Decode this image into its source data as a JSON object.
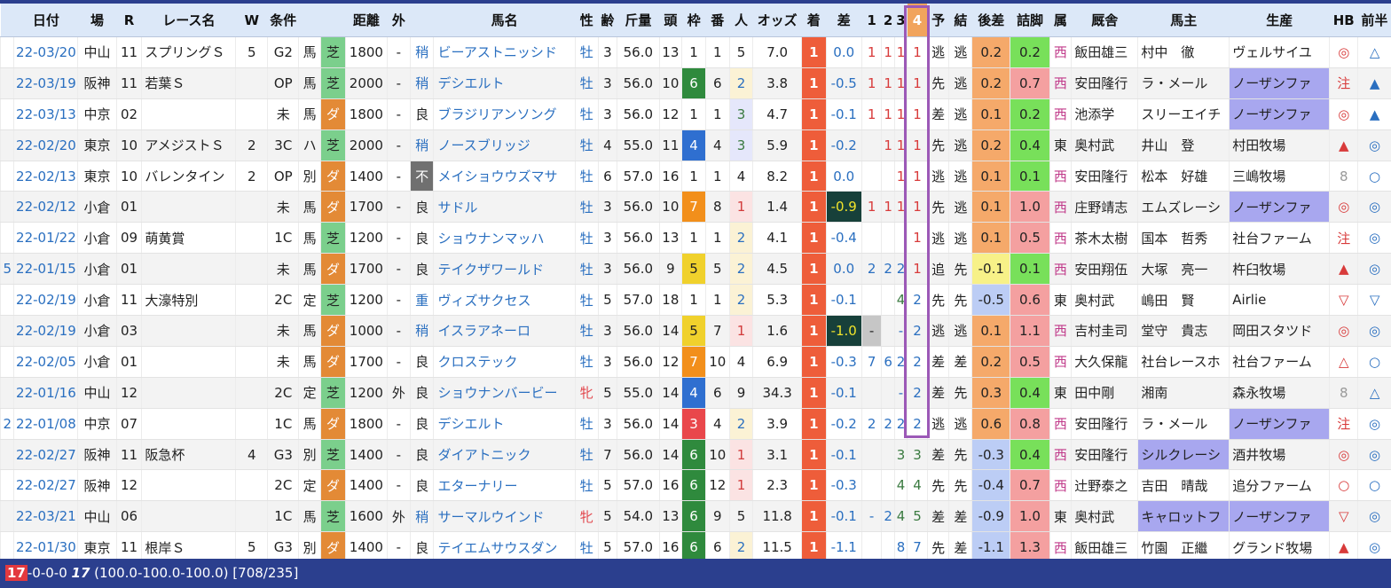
{
  "headers": [
    "",
    "日付",
    "場",
    "R",
    "レース名",
    "W",
    "条件",
    "",
    "",
    "距離",
    "外",
    "",
    "馬名",
    "性",
    "齢",
    "斤量",
    "頭",
    "枠",
    "番",
    "人",
    "オッズ",
    "着",
    "差",
    "1",
    "2",
    "3",
    "4",
    "予",
    "結",
    "後差",
    "詰脚",
    "属",
    "厩舎",
    "馬主",
    "生産",
    "HB",
    "前半"
  ],
  "rows": [
    {
      "pre": "",
      "date": "22-03/20",
      "venue": "中山",
      "r": "11",
      "race": "スプリングＳ",
      "w": "5",
      "grade": "G2",
      "cls": "馬",
      "surf": "芝",
      "dist": "1800",
      "out": "-",
      "cond": "稍",
      "horse": "ビーアストニッシド",
      "sex": "牡",
      "age": "3",
      "wt": "56.0",
      "field": "13",
      "gate": "1",
      "no": "1",
      "pop": "5",
      "odds": "7.0",
      "fin": "1",
      "margin": "0.0",
      "c1": "1",
      "c2": "1",
      "c3": "1",
      "c4": "1",
      "pred": "逃",
      "res": "逃",
      "late": "0.2",
      "kick": "0.2",
      "stable": "西",
      "trainer": "飯田雄三",
      "owner": "村中　徹",
      "breeder": "ヴェルサイユ",
      "hb": "◎",
      "half": "△"
    },
    {
      "pre": "",
      "date": "22-03/19",
      "venue": "阪神",
      "r": "11",
      "race": "若葉Ｓ",
      "w": "",
      "grade": "OP",
      "cls": "馬",
      "surf": "芝",
      "dist": "2000",
      "out": "-",
      "cond": "稍",
      "horse": "デシエルト",
      "sex": "牡",
      "age": "3",
      "wt": "56.0",
      "field": "10",
      "gate": "6",
      "no": "6",
      "pop": "2",
      "odds": "3.8",
      "fin": "1",
      "margin": "-0.5",
      "c1": "1",
      "c2": "1",
      "c3": "1",
      "c4": "1",
      "pred": "先",
      "res": "逃",
      "late": "0.2",
      "kick": "0.7",
      "stable": "西",
      "trainer": "安田隆行",
      "owner": "ラ・メール",
      "breeder": "ノーザンファ",
      "hb": "注",
      "half": "▲"
    },
    {
      "pre": "",
      "date": "22-03/13",
      "venue": "中京",
      "r": "02",
      "race": "",
      "w": "",
      "grade": "未",
      "cls": "馬",
      "surf": "ダ",
      "dist": "1800",
      "out": "-",
      "cond": "良",
      "horse": "ブラジリアンソング",
      "sex": "牡",
      "age": "3",
      "wt": "56.0",
      "field": "12",
      "gate": "1",
      "no": "1",
      "pop": "3",
      "odds": "4.7",
      "fin": "1",
      "margin": "-0.1",
      "c1": "1",
      "c2": "1",
      "c3": "1",
      "c4": "1",
      "pred": "差",
      "res": "逃",
      "late": "0.1",
      "kick": "0.2",
      "stable": "西",
      "trainer": "池添学",
      "owner": "スリーエイチ",
      "breeder": "ノーザンファ",
      "hb": "◎",
      "half": "▲"
    },
    {
      "pre": "",
      "date": "22-02/20",
      "venue": "東京",
      "r": "10",
      "race": "アメジストＳ",
      "w": "2",
      "grade": "3C",
      "cls": "ハ",
      "surf": "芝",
      "dist": "2000",
      "out": "-",
      "cond": "稍",
      "horse": "ノースブリッジ",
      "sex": "牡",
      "age": "4",
      "wt": "55.0",
      "field": "11",
      "gate": "4",
      "no": "4",
      "pop": "3",
      "odds": "5.9",
      "fin": "1",
      "margin": "-0.2",
      "c1": "",
      "c2": "1",
      "c3": "1",
      "c4": "1",
      "pred": "先",
      "res": "逃",
      "late": "0.2",
      "kick": "0.4",
      "stable": "東",
      "trainer": "奥村武",
      "owner": "井山　登",
      "breeder": "村田牧場",
      "hb": "▲",
      "half": "◎"
    },
    {
      "pre": "",
      "date": "22-02/13",
      "venue": "東京",
      "r": "10",
      "race": "バレンタイン",
      "w": "2",
      "grade": "OP",
      "cls": "別",
      "surf": "ダ",
      "dist": "1400",
      "out": "-",
      "cond": "不",
      "horse": "メイショウウズマサ",
      "sex": "牡",
      "age": "6",
      "wt": "57.0",
      "field": "16",
      "gate": "1",
      "no": "1",
      "pop": "4",
      "odds": "8.2",
      "fin": "1",
      "margin": "0.0",
      "c1": "",
      "c2": "",
      "c3": "1",
      "c4": "1",
      "pred": "逃",
      "res": "逃",
      "late": "0.1",
      "kick": "0.1",
      "stable": "西",
      "trainer": "安田隆行",
      "owner": "松本　好雄",
      "breeder": "三嶋牧場",
      "hb": "8",
      "half": "○"
    },
    {
      "pre": "",
      "date": "22-02/12",
      "venue": "小倉",
      "r": "01",
      "race": "",
      "w": "",
      "grade": "未",
      "cls": "馬",
      "surf": "ダ",
      "dist": "1700",
      "out": "-",
      "cond": "良",
      "horse": "サドル",
      "sex": "牡",
      "age": "3",
      "wt": "56.0",
      "field": "10",
      "gate": "7",
      "no": "8",
      "pop": "1",
      "odds": "1.4",
      "fin": "1",
      "margin": "-0.9",
      "c1": "1",
      "c2": "1",
      "c3": "1",
      "c4": "1",
      "pred": "先",
      "res": "逃",
      "late": "0.1",
      "kick": "1.0",
      "stable": "西",
      "trainer": "庄野靖志",
      "owner": "エムズレーシ",
      "breeder": "ノーザンファ",
      "hb": "◎",
      "half": "◎"
    },
    {
      "pre": "",
      "date": "22-01/22",
      "venue": "小倉",
      "r": "09",
      "race": "萌黄賞",
      "w": "",
      "grade": "1C",
      "cls": "馬",
      "surf": "芝",
      "dist": "1200",
      "out": "-",
      "cond": "良",
      "horse": "ショウナンマッハ",
      "sex": "牡",
      "age": "3",
      "wt": "56.0",
      "field": "13",
      "gate": "1",
      "no": "1",
      "pop": "2",
      "odds": "4.1",
      "fin": "1",
      "margin": "-0.4",
      "c1": "",
      "c2": "",
      "c3": "",
      "c4": "1",
      "pred": "逃",
      "res": "逃",
      "late": "0.1",
      "kick": "0.5",
      "stable": "西",
      "trainer": "茶木太樹",
      "owner": "国本　哲秀",
      "breeder": "社台ファーム",
      "hb": "注",
      "half": "◎"
    },
    {
      "pre": "5",
      "date": "22-01/15",
      "venue": "小倉",
      "r": "01",
      "race": "",
      "w": "",
      "grade": "未",
      "cls": "馬",
      "surf": "ダ",
      "dist": "1700",
      "out": "-",
      "cond": "良",
      "horse": "テイクザワールド",
      "sex": "牡",
      "age": "3",
      "wt": "56.0",
      "field": "9",
      "gate": "5",
      "no": "5",
      "pop": "2",
      "odds": "4.5",
      "fin": "1",
      "margin": "0.0",
      "c1": "2",
      "c2": "2",
      "c3": "2",
      "c4": "1",
      "pred": "追",
      "res": "先",
      "late": "-0.1",
      "kick": "0.1",
      "stable": "西",
      "trainer": "安田翔伍",
      "owner": "大塚　亮一",
      "breeder": "杵臼牧場",
      "hb": "▲",
      "half": "◎"
    },
    {
      "pre": "",
      "date": "22-02/19",
      "venue": "小倉",
      "r": "11",
      "race": "大濠特別",
      "w": "",
      "grade": "2C",
      "cls": "定",
      "surf": "芝",
      "dist": "1200",
      "out": "-",
      "cond": "重",
      "horse": "ヴィズサクセス",
      "sex": "牡",
      "age": "5",
      "wt": "57.0",
      "field": "18",
      "gate": "1",
      "no": "1",
      "pop": "2",
      "odds": "5.3",
      "fin": "1",
      "margin": "-0.1",
      "c1": "",
      "c2": "",
      "c3": "4",
      "c4": "2",
      "pred": "先",
      "res": "先",
      "late": "-0.5",
      "kick": "0.6",
      "stable": "東",
      "trainer": "奥村武",
      "owner": "嶋田　賢",
      "breeder": "Airlie",
      "hb": "▽",
      "half": "▽"
    },
    {
      "pre": "",
      "date": "22-02/19",
      "venue": "小倉",
      "r": "03",
      "race": "",
      "w": "",
      "grade": "未",
      "cls": "馬",
      "surf": "ダ",
      "dist": "1000",
      "out": "-",
      "cond": "稍",
      "horse": "イスラアネーロ",
      "sex": "牡",
      "age": "3",
      "wt": "56.0",
      "field": "14",
      "gate": "5",
      "no": "7",
      "pop": "1",
      "odds": "1.6",
      "fin": "1",
      "margin": "-1.0",
      "c1": "-",
      "c2": "",
      "c3": "-",
      "c4": "2",
      "pred": "逃",
      "res": "逃",
      "late": "0.1",
      "kick": "1.1",
      "stable": "西",
      "trainer": "吉村圭司",
      "owner": "堂守　貴志",
      "breeder": "岡田スタツド",
      "hb": "◎",
      "half": "◎"
    },
    {
      "pre": "",
      "date": "22-02/05",
      "venue": "小倉",
      "r": "01",
      "race": "",
      "w": "",
      "grade": "未",
      "cls": "馬",
      "surf": "ダ",
      "dist": "1700",
      "out": "-",
      "cond": "良",
      "horse": "クロステック",
      "sex": "牡",
      "age": "3",
      "wt": "56.0",
      "field": "12",
      "gate": "7",
      "no": "10",
      "pop": "4",
      "odds": "6.9",
      "fin": "1",
      "margin": "-0.3",
      "c1": "7",
      "c2": "6",
      "c3": "2",
      "c4": "2",
      "pred": "差",
      "res": "差",
      "late": "0.2",
      "kick": "0.5",
      "stable": "西",
      "trainer": "大久保龍",
      "owner": "社台レースホ",
      "breeder": "社台ファーム",
      "hb": "△",
      "half": "○"
    },
    {
      "pre": "",
      "date": "22-01/16",
      "venue": "中山",
      "r": "12",
      "race": "",
      "w": "",
      "grade": "2C",
      "cls": "定",
      "surf": "芝",
      "dist": "1200",
      "out": "外",
      "cond": "良",
      "horse": "ショウナンバービー",
      "sex": "牝",
      "age": "5",
      "wt": "55.0",
      "field": "14",
      "gate": "4",
      "no": "6",
      "pop": "9",
      "odds": "34.3",
      "fin": "1",
      "margin": "-0.1",
      "c1": "",
      "c2": "",
      "c3": "-",
      "c4": "2",
      "pred": "差",
      "res": "先",
      "late": "0.3",
      "kick": "0.4",
      "stable": "東",
      "trainer": "田中剛",
      "owner": "湘南",
      "breeder": "森永牧場",
      "hb": "8",
      "half": "△"
    },
    {
      "pre": "2",
      "date": "22-01/08",
      "venue": "中京",
      "r": "07",
      "race": "",
      "w": "",
      "grade": "1C",
      "cls": "馬",
      "surf": "ダ",
      "dist": "1800",
      "out": "-",
      "cond": "良",
      "horse": "デシエルト",
      "sex": "牡",
      "age": "3",
      "wt": "56.0",
      "field": "14",
      "gate": "3",
      "no": "4",
      "pop": "2",
      "odds": "3.9",
      "fin": "1",
      "margin": "-0.2",
      "c1": "2",
      "c2": "2",
      "c3": "2",
      "c4": "2",
      "pred": "逃",
      "res": "逃",
      "late": "0.6",
      "kick": "0.8",
      "stable": "西",
      "trainer": "安田隆行",
      "owner": "ラ・メール",
      "breeder": "ノーザンファ",
      "hb": "注",
      "half": "◎"
    },
    {
      "pre": "",
      "date": "22-02/27",
      "venue": "阪神",
      "r": "11",
      "race": "阪急杯",
      "w": "4",
      "grade": "G3",
      "cls": "別",
      "surf": "芝",
      "dist": "1400",
      "out": "-",
      "cond": "良",
      "horse": "ダイアトニック",
      "sex": "牡",
      "age": "7",
      "wt": "56.0",
      "field": "14",
      "gate": "6",
      "no": "10",
      "pop": "1",
      "odds": "3.1",
      "fin": "1",
      "margin": "-0.1",
      "c1": "",
      "c2": "",
      "c3": "3",
      "c4": "3",
      "pred": "差",
      "res": "先",
      "late": "-0.3",
      "kick": "0.4",
      "stable": "西",
      "trainer": "安田隆行",
      "owner": "シルクレーシ",
      "breeder": "酒井牧場",
      "hb": "◎",
      "half": "◎"
    },
    {
      "pre": "",
      "date": "22-02/27",
      "venue": "阪神",
      "r": "12",
      "race": "",
      "w": "",
      "grade": "2C",
      "cls": "定",
      "surf": "ダ",
      "dist": "1400",
      "out": "-",
      "cond": "良",
      "horse": "エターナリー",
      "sex": "牡",
      "age": "5",
      "wt": "57.0",
      "field": "16",
      "gate": "6",
      "no": "12",
      "pop": "1",
      "odds": "2.3",
      "fin": "1",
      "margin": "-0.3",
      "c1": "",
      "c2": "",
      "c3": "4",
      "c4": "4",
      "pred": "先",
      "res": "先",
      "late": "-0.4",
      "kick": "0.7",
      "stable": "西",
      "trainer": "辻野泰之",
      "owner": "吉田　晴哉",
      "breeder": "追分ファーム",
      "hb": "○",
      "half": "○"
    },
    {
      "pre": "",
      "date": "22-03/21",
      "venue": "中山",
      "r": "06",
      "race": "",
      "w": "",
      "grade": "1C",
      "cls": "馬",
      "surf": "芝",
      "dist": "1600",
      "out": "外",
      "cond": "稍",
      "horse": "サーマルウインド",
      "sex": "牝",
      "age": "5",
      "wt": "54.0",
      "field": "13",
      "gate": "6",
      "no": "9",
      "pop": "5",
      "odds": "11.8",
      "fin": "1",
      "margin": "-0.1",
      "c1": "-",
      "c2": "2",
      "c3": "4",
      "c4": "5",
      "pred": "差",
      "res": "差",
      "late": "-0.9",
      "kick": "1.0",
      "stable": "東",
      "trainer": "奥村武",
      "owner": "キャロットフ",
      "breeder": "ノーザンファ",
      "hb": "▽",
      "half": "◎"
    },
    {
      "pre": "",
      "date": "22-01/30",
      "venue": "東京",
      "r": "11",
      "race": "根岸Ｓ",
      "w": "5",
      "grade": "G3",
      "cls": "別",
      "surf": "ダ",
      "dist": "1400",
      "out": "-",
      "cond": "良",
      "horse": "テイエムサウスダン",
      "sex": "牡",
      "age": "5",
      "wt": "57.0",
      "field": "16",
      "gate": "6",
      "no": "6",
      "pop": "2",
      "odds": "11.5",
      "fin": "1",
      "margin": "-1.1",
      "c1": "",
      "c2": "",
      "c3": "8",
      "c4": "7",
      "pred": "先",
      "res": "差",
      "late": "-1.1",
      "kick": "1.3",
      "stable": "西",
      "trainer": "飯田雄三",
      "owner": "竹園　正繼",
      "breeder": "グランド牧場",
      "hb": "▲",
      "half": "◎"
    }
  ],
  "footer": {
    "badge": "17",
    "record": "-0-0-0 ",
    "count": "17",
    "rates": " (100.0-100.0-100.0) ",
    "ratio": "[708/235]"
  },
  "colors": {
    "header_bg": "#dce8f8",
    "highlight_col": "#f1a45d",
    "overlay_border": "#9c59b7",
    "footer_bg": "#2b3f8e"
  }
}
